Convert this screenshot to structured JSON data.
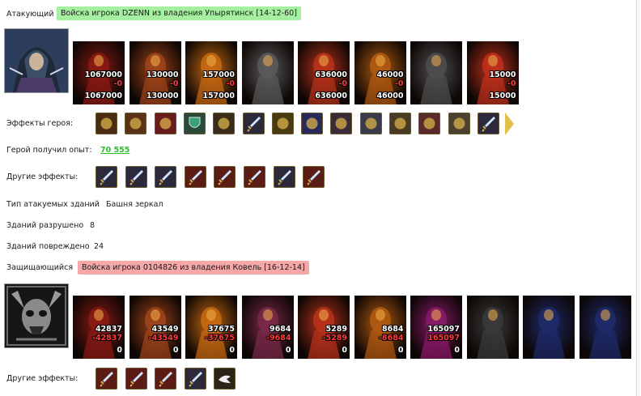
{
  "attacker": {
    "label": "Атакующий",
    "army_title": "Войска игрока DZENN из владения Упырятинск [14-12-60]",
    "hero_portrait": "hooded-assassin-hero",
    "units": [
      {
        "name": "red-beast",
        "count": "1067000",
        "loss": "-0",
        "remain": "1067000",
        "color": "#8b1a14"
      },
      {
        "name": "fire-skeleton",
        "count": "130000",
        "loss": "-0",
        "remain": "130000",
        "color": "#a0441a"
      },
      {
        "name": "fire-golem",
        "count": "157000",
        "loss": "-0",
        "remain": "157000",
        "color": "#c86a12"
      },
      {
        "name": "stone-gargoyle",
        "count": "",
        "loss": "",
        "remain": "",
        "color": "#5a5a5a"
      },
      {
        "name": "lava-demon",
        "count": "636000",
        "loss": "-0",
        "remain": "636000",
        "color": "#b8321a"
      },
      {
        "name": "flame-warrior",
        "count": "46000",
        "loss": "-0",
        "remain": "46000",
        "color": "#b25a10"
      },
      {
        "name": "stone-minotaur",
        "count": "",
        "loss": "",
        "remain": "",
        "color": "#4e4e4e"
      },
      {
        "name": "fire-mage",
        "count": "15000",
        "loss": "-0",
        "remain": "15000",
        "color": "#c0301c"
      }
    ],
    "hero_effects_label": "Эффекты героя:",
    "hero_effects": [
      "bag-icon",
      "helmet-icon",
      "dice-icon",
      "shield-icon",
      "handshake-icon",
      "sword-green-icon",
      "handshake-gold-icon",
      "hand-spell-icon",
      "skull-helmet-icon",
      "pentagram-icon",
      "armor-icon",
      "crossbow-icon",
      "tent-icon",
      "blade-icon"
    ],
    "experience_label": "Герой получил опыт:",
    "experience_value": "70 555",
    "other_effects_label": "Другие эффекты:",
    "other_effects": [
      "sword-blue-icon",
      "sword-blue-icon",
      "sword-blue-icon",
      "sword-red-icon",
      "sword-red-icon",
      "sword-red-icon",
      "sword-blue-icon",
      "sword-red-icon"
    ]
  },
  "buildings": {
    "type_label": "Тип атакуемых зданий",
    "type_value": "Башня зеркал",
    "destroyed_label": "Зданий разрушено",
    "destroyed_value": "8",
    "damaged_label": "Зданий повреждено",
    "damaged_value": "24"
  },
  "defender": {
    "label": "Защищающийся",
    "army_title": "Войска игрока 0104826 из владения Ковель [16-12-14]",
    "hero_portrait": "demon-skull-crest",
    "units": [
      {
        "name": "red-beast",
        "count": "42837",
        "loss": "-42837",
        "remain": "0",
        "color": "#8b1a14"
      },
      {
        "name": "fire-skeleton",
        "count": "43549",
        "loss": "-43549",
        "remain": "0",
        "color": "#a0441a"
      },
      {
        "name": "fire-golem",
        "count": "37675",
        "loss": "-37675",
        "remain": "0",
        "color": "#c86a12"
      },
      {
        "name": "bone-dragon",
        "count": "9684",
        "loss": "-9684",
        "remain": "0",
        "color": "#7a2a4a"
      },
      {
        "name": "lava-demon",
        "count": "5289",
        "loss": "-5289",
        "remain": "0",
        "color": "#b8321a"
      },
      {
        "name": "flame-warrior",
        "count": "8684",
        "loss": "-8684",
        "remain": "0",
        "color": "#b25a10"
      },
      {
        "name": "demon-lord",
        "count": "165097",
        "loss": "165097",
        "remain": "0",
        "color": "#8a1a6a"
      },
      {
        "name": "shadow-wraith",
        "count": "",
        "loss": "",
        "remain": "",
        "color": "#3a3a3a"
      },
      {
        "name": "spike-tower",
        "count": "",
        "loss": "",
        "remain": "",
        "color": "#1e2a6a"
      },
      {
        "name": "spike-tower",
        "count": "",
        "loss": "",
        "remain": "",
        "color": "#1e2a6a"
      }
    ],
    "other_effects_label": "Другие эффекты:",
    "other_effects": [
      "sword-red-icon",
      "sword-red-icon",
      "sword-red-icon",
      "sword-blue-icon",
      "dove-icon"
    ]
  }
}
